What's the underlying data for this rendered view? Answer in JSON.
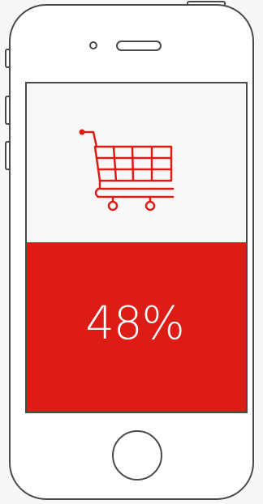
{
  "device": {
    "type": "smartphone-outline",
    "frame_color": "#4a4a4a"
  },
  "screen": {
    "icon": "shopping-cart-icon",
    "icon_color": "#dc1c15",
    "panel_color": "#dc1c15",
    "stat": {
      "value": "48%"
    }
  }
}
